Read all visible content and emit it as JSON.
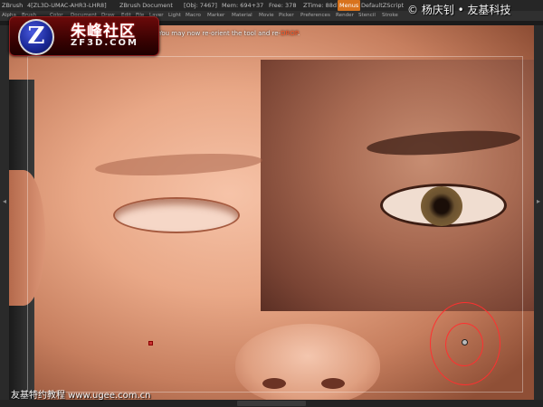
{
  "titlebar": {
    "app_name": "ZBrush",
    "build": "4[ZL3D-UMAC-AHR3-LHR8]",
    "document": "ZBrush Document",
    "objects": "[Obj: 7467]",
    "mem": "Mem: 694+37",
    "free": "Free: 378",
    "ztime": "ZTime: 88d",
    "menus_label": "Menus",
    "script": "DefaultZScript"
  },
  "menubar": {
    "items": [
      "Alpha",
      "Brush",
      "Color",
      "Document",
      "Draw",
      "Edit",
      "File",
      "Layer",
      "Light",
      "Macro",
      "Marker",
      "Material",
      "Movie",
      "Picker",
      "Preferences",
      "Render",
      "Stencil",
      "Stroke"
    ]
  },
  "watermarks": {
    "top_right": "© 杨庆钊 • 友基科技",
    "bottom_left": "友基特约教程  www.ugee.com.cn"
  },
  "logo": {
    "glyph": "Z",
    "chinese": "朱峰社区",
    "site": "ZF3D.COM"
  },
  "canvas": {
    "hint_prefix": "You may now re-orient the tool and re-",
    "hint_drop": "DROP",
    "hint_suffix": "."
  },
  "icons": {
    "left_arrow": "◂",
    "right_arrow": "▸"
  },
  "colors": {
    "menus_button": "#d8731d",
    "drop_text": "#ff5a2a",
    "brush_cursor": "#ff3030"
  }
}
